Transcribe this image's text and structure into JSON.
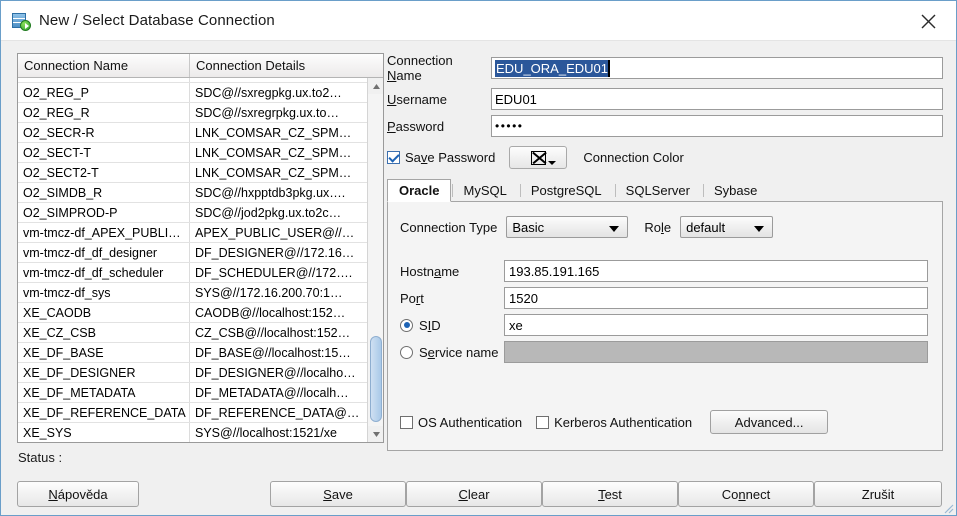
{
  "window": {
    "title": "New / Select Database Connection",
    "icon": "database-connection-icon",
    "close_label": "✕"
  },
  "list": {
    "headers": [
      "Connection Name",
      "Connection Details"
    ],
    "rows": [
      {
        "name": "O2_REG_P",
        "details": "SDC@//sxregpkg.ux.to2…"
      },
      {
        "name": "O2_REG_R",
        "details": "SDC@//sxregrpkg.ux.to…"
      },
      {
        "name": "O2_SECR-R",
        "details": "LNK_COMSAR_CZ_SPM…"
      },
      {
        "name": "O2_SECT-T",
        "details": "LNK_COMSAR_CZ_SPM…"
      },
      {
        "name": "O2_SECT2-T",
        "details": "LNK_COMSAR_CZ_SPM…"
      },
      {
        "name": "O2_SIMDB_R",
        "details": "SDC@//hxpptdb3pkg.ux…."
      },
      {
        "name": "O2_SIMPROD-P",
        "details": "SDC@//jod2pkg.ux.to2c…"
      },
      {
        "name": "vm-tmcz-df_APEX_PUBLI…",
        "details": "APEX_PUBLIC_USER@//…"
      },
      {
        "name": "vm-tmcz-df_df_designer",
        "details": "DF_DESIGNER@//172.16…"
      },
      {
        "name": "vm-tmcz-df_df_scheduler",
        "details": "DF_SCHEDULER@//172…."
      },
      {
        "name": "vm-tmcz-df_sys",
        "details": "SYS@//172.16.200.70:1…"
      },
      {
        "name": "XE_CAODB",
        "details": "CAODB@//localhost:152…"
      },
      {
        "name": "XE_CZ_CSB",
        "details": "CZ_CSB@//localhost:152…"
      },
      {
        "name": "XE_DF_BASE",
        "details": "DF_BASE@//localhost:15…"
      },
      {
        "name": "XE_DF_DESIGNER",
        "details": "DF_DESIGNER@//localho…"
      },
      {
        "name": "XE_DF_METADATA",
        "details": "DF_METADATA@//localh…"
      },
      {
        "name": "XE_DF_REFERENCE_DATA",
        "details": "DF_REFERENCE_DATA@…"
      },
      {
        "name": "XE_SYS",
        "details": "SYS@//localhost:1521/xe"
      }
    ],
    "scroll_up": "▲",
    "scroll_down": "▼"
  },
  "status": {
    "label": "Status :"
  },
  "form": {
    "connection_name_label": "Connection Name",
    "connection_name_value": "EDU_ORA_EDU01",
    "username_label": "Username",
    "username_value": "EDU01",
    "password_label": "Password",
    "password_value": "•••••",
    "save_password_label": "Save Password",
    "save_password_checked": true,
    "connection_color_label": "Connection Color",
    "connection_color_value": "none"
  },
  "tabs": {
    "items": [
      {
        "label": "Oracle",
        "active": true
      },
      {
        "label": "MySQL",
        "active": false
      },
      {
        "label": "PostgreSQL",
        "active": false
      },
      {
        "label": "SQLServer",
        "active": false
      },
      {
        "label": "Sybase",
        "active": false
      }
    ]
  },
  "oracle": {
    "connection_type_label": "Connection Type",
    "connection_type_value": "Basic",
    "role_label": "Role",
    "role_value": "default",
    "hostname_label": "Hostname",
    "hostname_value": "193.85.191.165",
    "port_label": "Port",
    "port_value": "1520",
    "sid_label": "SID",
    "sid_value": "xe",
    "sid_selected": true,
    "service_name_label": "Service name",
    "service_name_value": "",
    "service_name_selected": false,
    "os_auth_label": "OS Authentication",
    "os_auth_checked": false,
    "kerberos_label": "Kerberos Authentication",
    "kerberos_checked": false,
    "advanced_label": "Advanced..."
  },
  "footer": {
    "help": "Nápověda",
    "save": "Save",
    "clear": "Clear",
    "test": "Test",
    "connect": "Connect",
    "cancel": "Zrušit"
  },
  "colors": {
    "selection": "#2b579a",
    "accent": "#1d63b5",
    "window_bg": "#f0f0f0",
    "border": "#6a9ec9"
  }
}
